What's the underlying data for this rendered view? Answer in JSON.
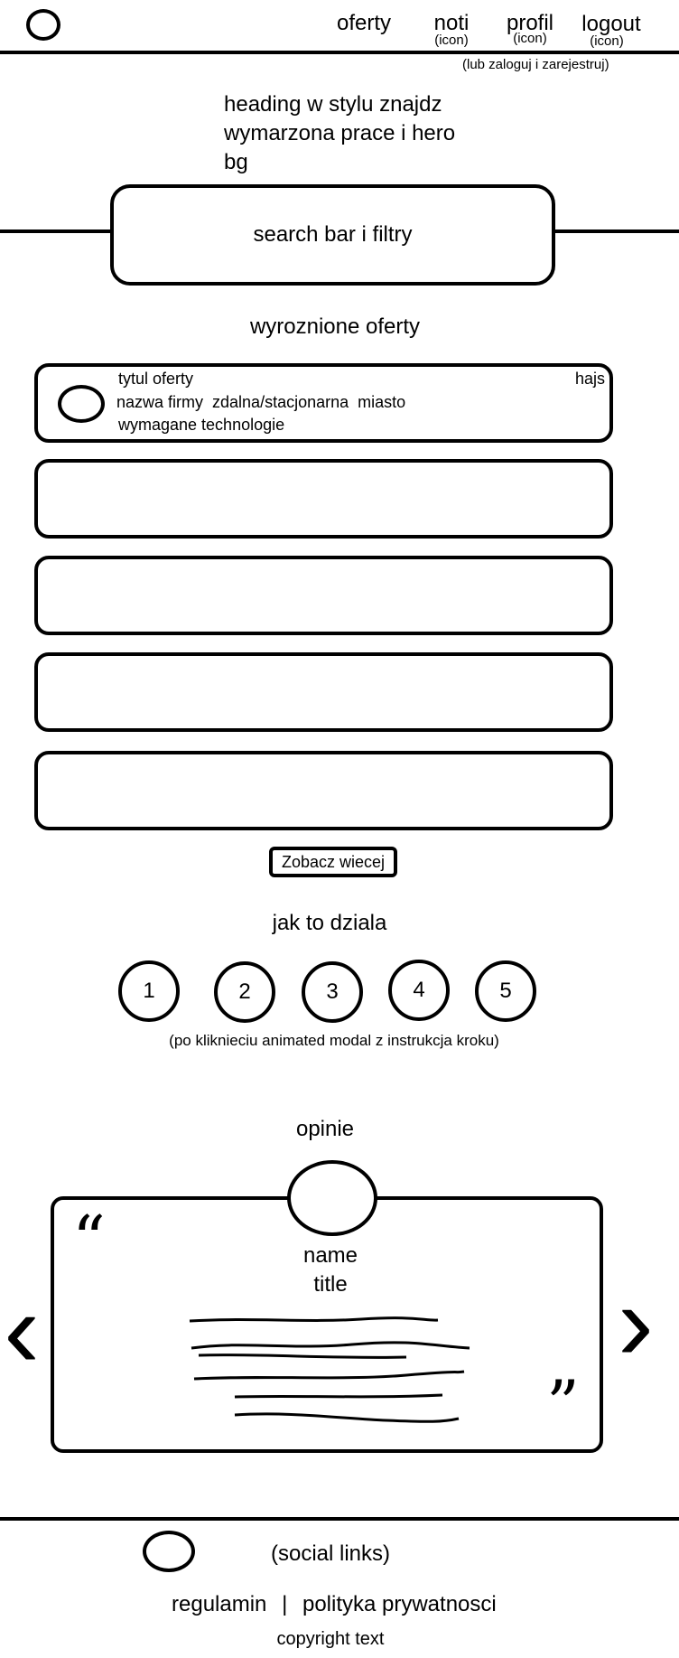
{
  "header": {
    "nav": {
      "oferty": "oferty",
      "noti": "noti",
      "noti_sub": "(icon)",
      "profil": "profil",
      "profil_sub": "(icon)",
      "logout": "logout",
      "logout_sub": "(icon)"
    },
    "auth_note": "(lub zaloguj i zarejestruj)"
  },
  "hero": {
    "heading_lines": [
      "heading w stylu znajdz",
      "wymarzona prace i hero",
      "bg"
    ],
    "search_label": "search bar i filtry"
  },
  "featured": {
    "title": "wyroznione oferty",
    "first_offer": {
      "title": "tytul oferty",
      "salary": "hajs",
      "details": "nazwa firmy  zdalna/stacjonarna  miasto",
      "tech": "wymagane technologie"
    },
    "see_more": "Zobacz wiecej"
  },
  "how_it_works": {
    "title": "jak to dziala",
    "steps": [
      "1",
      "2",
      "3",
      "4",
      "5"
    ],
    "note": "(po kliknieciu animated modal z instrukcja kroku)"
  },
  "opinions": {
    "title": "opinie",
    "name": "name",
    "person_title": "title",
    "quote_open": "“",
    "quote_close": "”",
    "prev_symbol": "‹",
    "next_symbol": "›"
  },
  "footer": {
    "social": "(social links)",
    "regulamin": "regulamin",
    "separator": "|",
    "privacy": "polityka prywatnosci",
    "copyright": "copyright text"
  }
}
